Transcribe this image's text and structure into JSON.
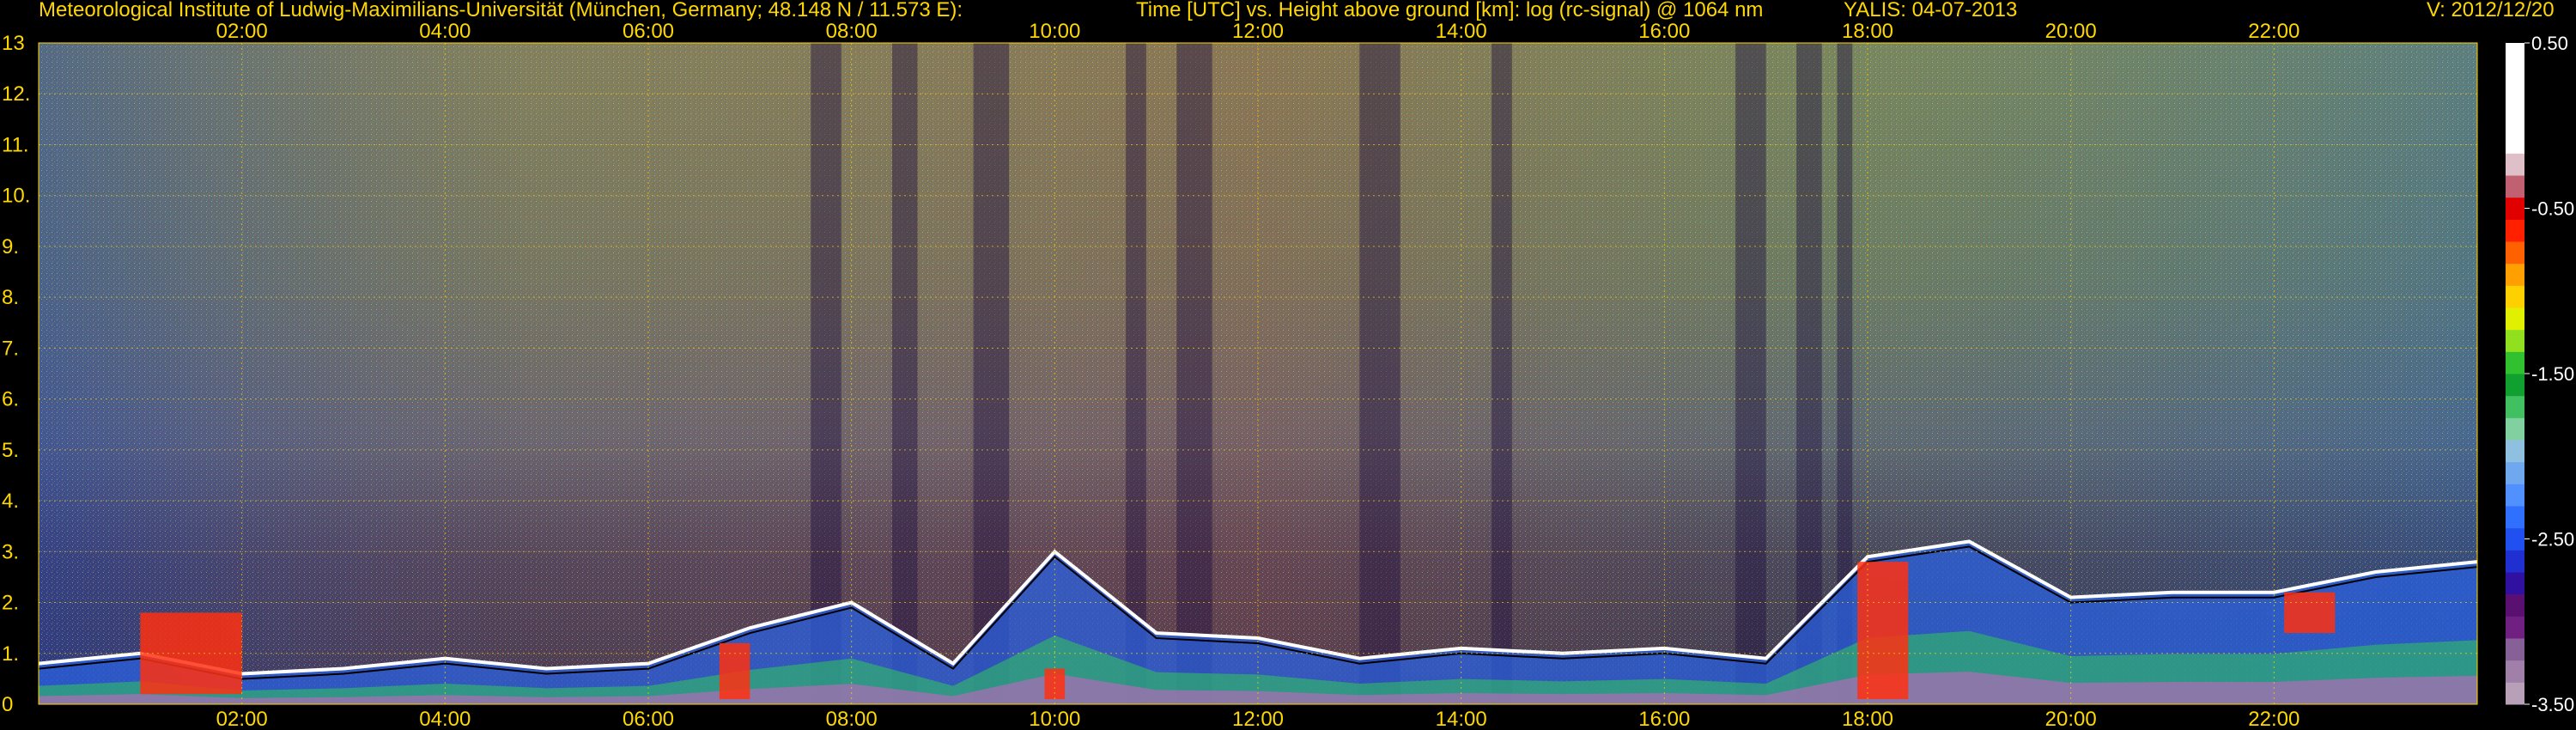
{
  "header": {
    "institute": "Meteorological Institute of Ludwig-Maximilians-Universität (München, Germany; 48.148 N / 11.573 E):",
    "axes_desc": "Time [UTC] vs. Height above ground [km]: log (rc-signal) @ 1064 nm",
    "instrument_date": "YALIS: 04-07-2013",
    "version": "V: 2012/12/20"
  },
  "chart_data": {
    "type": "heatmap",
    "title": "Time [UTC] vs. Height above ground [km]: log (rc-signal) @ 1064 nm",
    "xlabel": "Time [UTC]",
    "ylabel": "Height above ground [km]",
    "xlim_hours": [
      0,
      24
    ],
    "ylim_km": [
      0,
      13
    ],
    "x_ticks": [
      "02:00",
      "04:00",
      "06:00",
      "08:00",
      "10:00",
      "12:00",
      "14:00",
      "16:00",
      "18:00",
      "20:00",
      "22:00"
    ],
    "x_tick_hours": [
      2,
      4,
      6,
      8,
      10,
      12,
      14,
      16,
      18,
      20,
      22
    ],
    "y_ticks": [
      "0",
      "1.",
      "2.",
      "3.",
      "4.",
      "5.",
      "6.",
      "7.",
      "8.",
      "9.",
      "10.",
      "11.",
      "12.",
      "13"
    ],
    "y_tick_values": [
      0,
      1,
      2,
      3,
      4,
      5,
      6,
      7,
      8,
      9,
      10,
      11,
      12,
      13
    ],
    "grid": true,
    "colorbar": {
      "range": [
        -3.5,
        0.5
      ],
      "ticks": [
        "0.50",
        "-0.50",
        "-1.50",
        "-2.50",
        "-3.50"
      ],
      "tick_values": [
        0.5,
        -0.5,
        -1.5,
        -2.5,
        -3.5
      ],
      "colors": [
        "#b8a0b8",
        "#a080a8",
        "#886098",
        "#702080",
        "#5a1070",
        "#3010a0",
        "#2030d0",
        "#2050f0",
        "#3070ff",
        "#5090ff",
        "#70a8f0",
        "#90c0e0",
        "#80d0a0",
        "#40c060",
        "#10a030",
        "#30c030",
        "#90e020",
        "#e0f000",
        "#ffd000",
        "#ffa000",
        "#ff6000",
        "#ff2000",
        "#e00000",
        "#c06070",
        "#e0c0c8",
        "#ffffff",
        "#ffffff",
        "#ffffff",
        "#ffffff",
        "#ffffff"
      ]
    },
    "boundary_layer_top_km": [
      [
        0.0,
        0.8
      ],
      [
        1.0,
        1.0
      ],
      [
        2.0,
        0.6
      ],
      [
        3.0,
        0.7
      ],
      [
        4.0,
        0.9
      ],
      [
        5.0,
        0.7
      ],
      [
        6.0,
        0.8
      ],
      [
        7.0,
        1.5
      ],
      [
        8.0,
        2.0
      ],
      [
        9.0,
        0.8
      ],
      [
        10.0,
        3.0
      ],
      [
        11.0,
        1.4
      ],
      [
        12.0,
        1.3
      ],
      [
        13.0,
        0.9
      ],
      [
        14.0,
        1.1
      ],
      [
        15.0,
        1.0
      ],
      [
        16.0,
        1.1
      ],
      [
        17.0,
        0.9
      ],
      [
        18.0,
        2.9
      ],
      [
        19.0,
        3.2
      ],
      [
        20.0,
        2.1
      ],
      [
        21.0,
        2.2
      ],
      [
        22.0,
        2.2
      ],
      [
        23.0,
        2.6
      ],
      [
        24.0,
        2.8
      ]
    ]
  }
}
